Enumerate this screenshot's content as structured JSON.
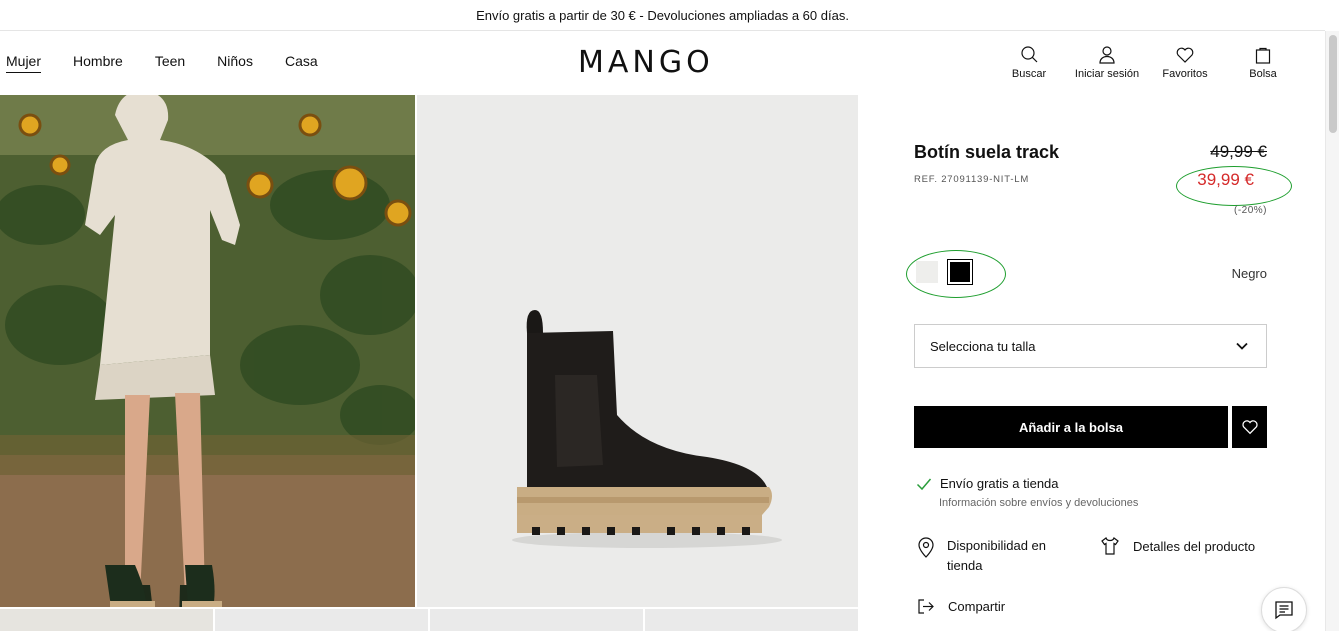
{
  "promo": {
    "text": "Envío gratis a partir de 30 € - Devoluciones ampliadas a 60 días."
  },
  "nav": {
    "items": [
      "Mujer",
      "Hombre",
      "Teen",
      "Niños",
      "Casa"
    ],
    "active": "Mujer"
  },
  "brand": {
    "logo": "MANGO"
  },
  "actions": {
    "search": "Buscar",
    "login": "Iniciar sesión",
    "favorites": "Favoritos",
    "bag": "Bolsa"
  },
  "product": {
    "title": "Botín suela track",
    "ref": "REF. 27091139-NIT-LM",
    "price_old": "49,99 €",
    "price_new": "39,99 €",
    "discount": "(-20%)",
    "selected_color": "Negro",
    "size_placeholder": "Selecciona tu talla",
    "add_to_bag": "Añadir a la bolsa",
    "shipping": "Envío gratis a tienda",
    "shipping_info": "Información sobre envíos y devoluciones",
    "availability": "Disponibilidad en tienda",
    "details": "Detalles del producto",
    "share": "Compartir"
  },
  "colors": {
    "accent": "#000000",
    "sale": "#d52a2a",
    "highlight_ring": "#1e9e2e",
    "check": "#2a9d3b"
  }
}
